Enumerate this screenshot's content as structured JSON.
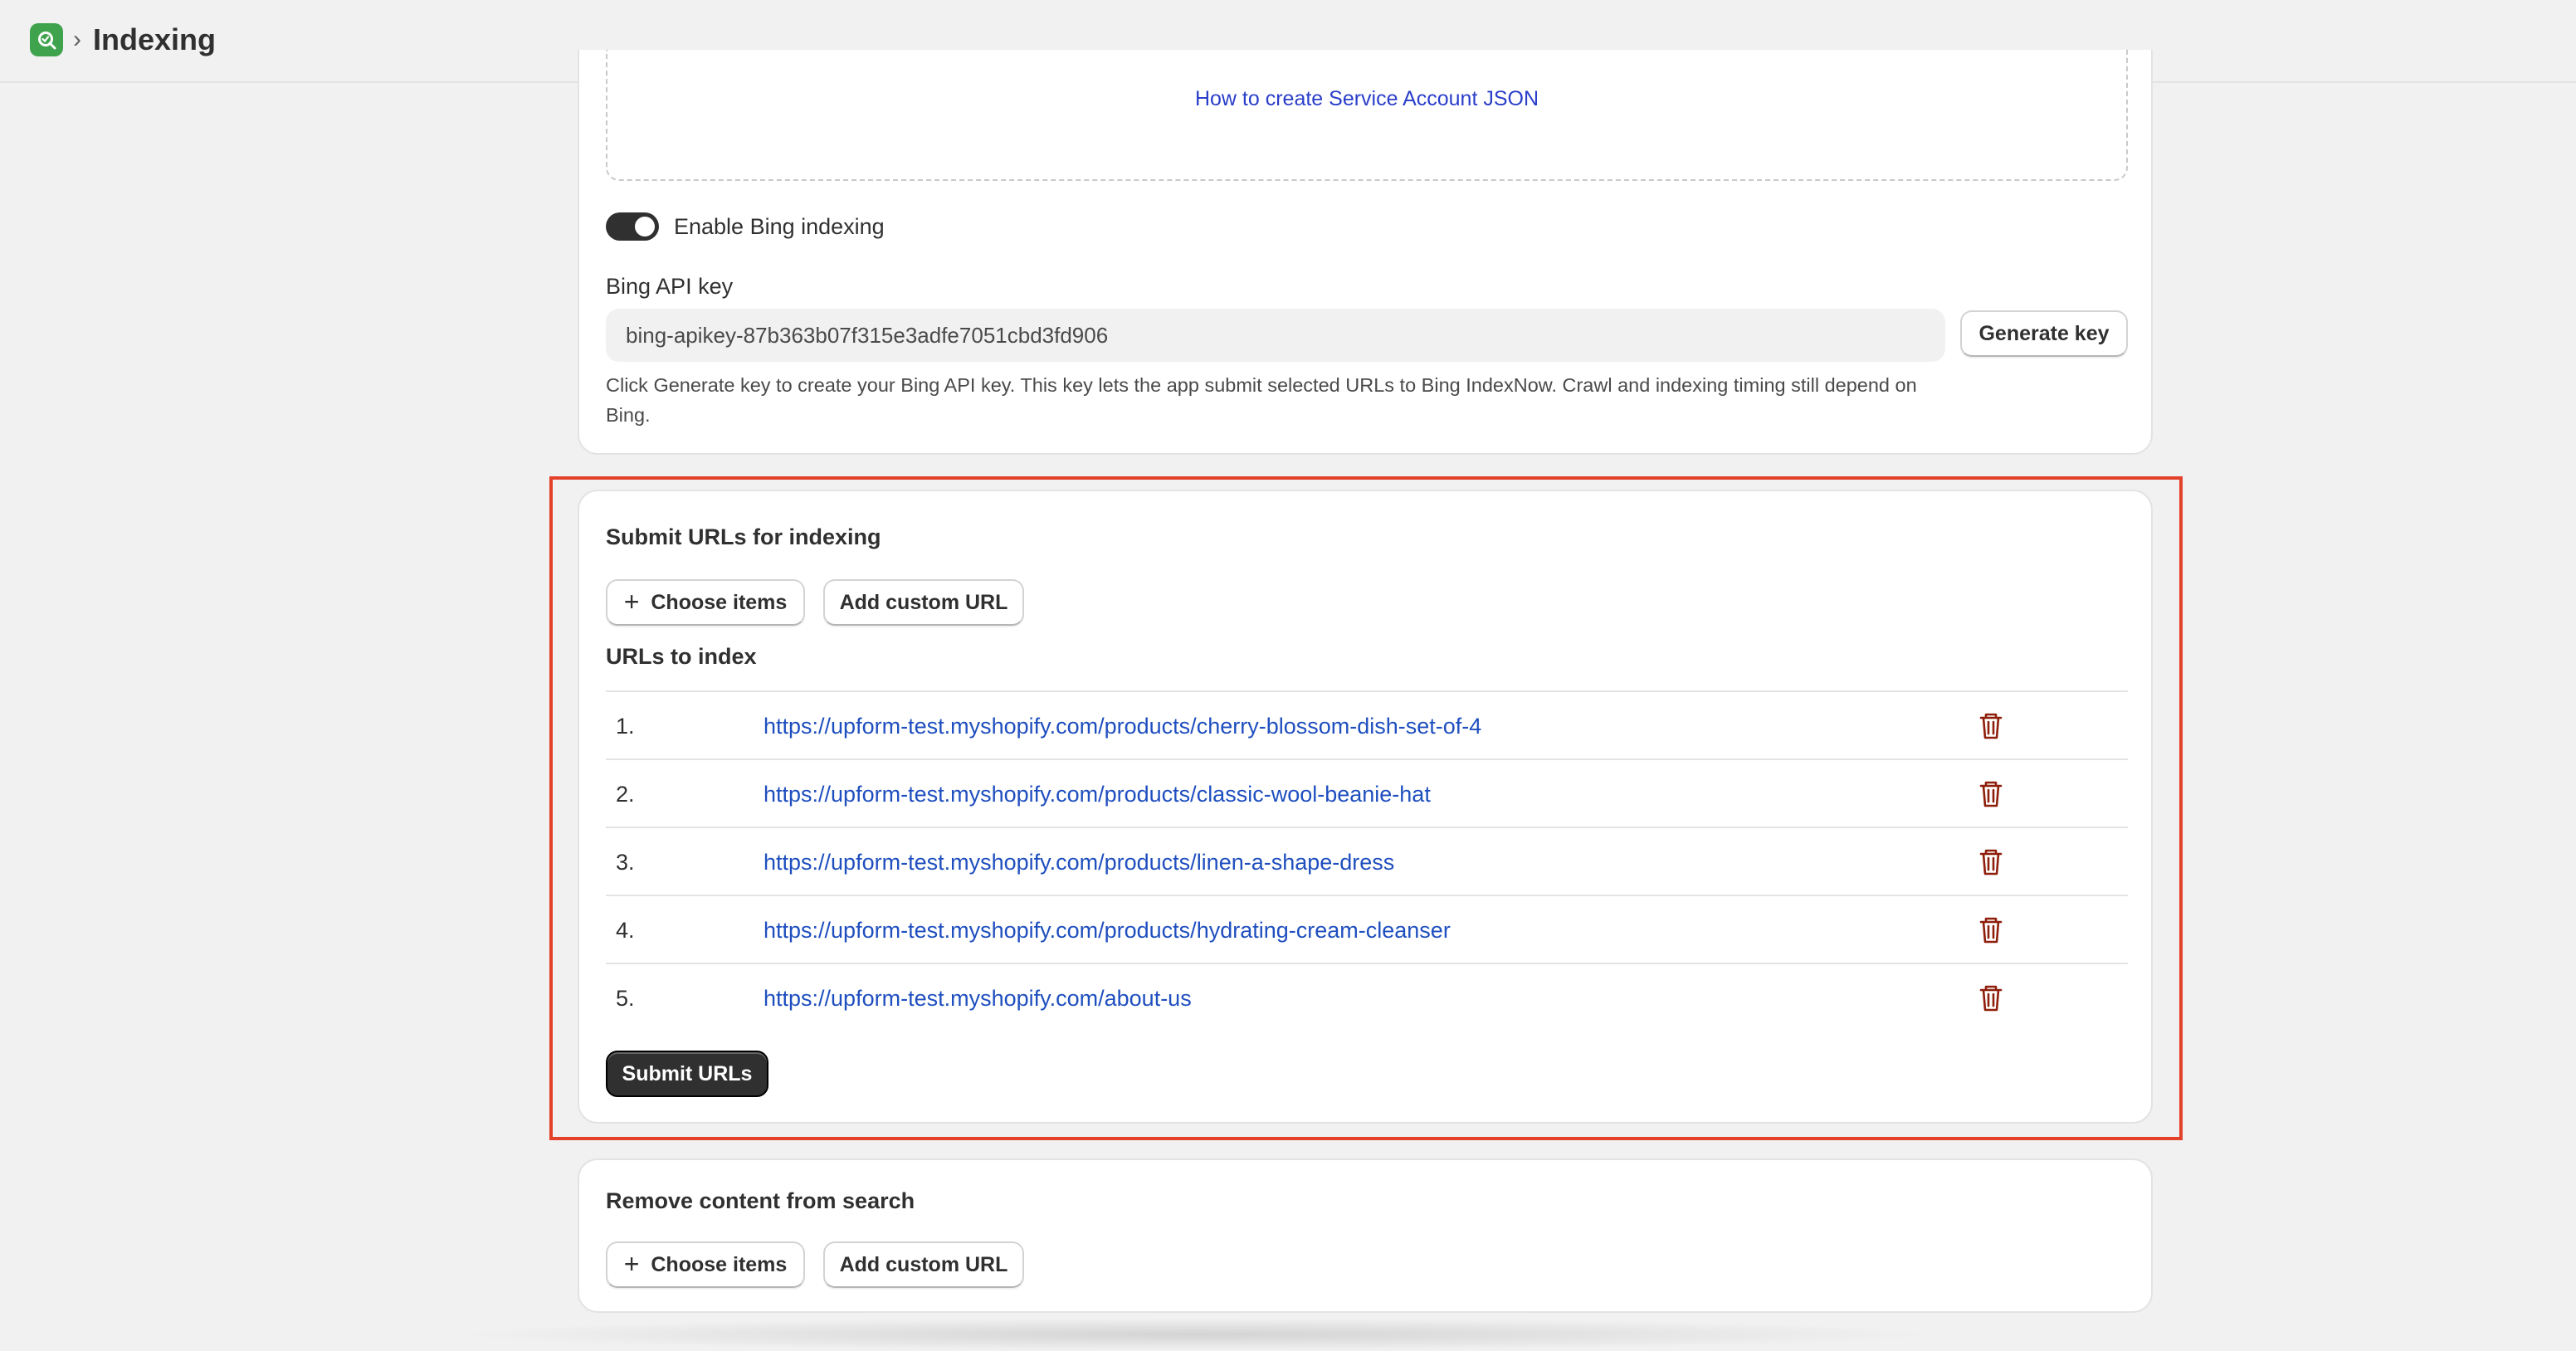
{
  "header": {
    "separator": "›",
    "title": "Indexing",
    "app_icon": "app-logo-icon"
  },
  "google_section": {
    "howto_link": "How to create Service Account JSON"
  },
  "bing": {
    "toggle_label": "Enable Bing indexing",
    "toggle_on": true,
    "api_key_label": "Bing API key",
    "api_key_value": "bing-apikey-87b363b07f315e3adfe7051cbd3fd906",
    "generate_label": "Generate key",
    "help_text": "Click Generate key to create your Bing API key. This key lets the app submit selected URLs to Bing IndexNow. Crawl and indexing timing still depend on Bing."
  },
  "submit_section": {
    "heading": "Submit URLs for indexing",
    "choose_label": "Choose items",
    "custom_label": "Add custom URL",
    "list_heading": "URLs to index",
    "urls": [
      {
        "num": "1.",
        "url": "https://upform-test.myshopify.com/products/cherry-blossom-dish-set-of-4"
      },
      {
        "num": "2.",
        "url": "https://upform-test.myshopify.com/products/classic-wool-beanie-hat"
      },
      {
        "num": "3.",
        "url": "https://upform-test.myshopify.com/products/linen-a-shape-dress"
      },
      {
        "num": "4.",
        "url": "https://upform-test.myshopify.com/products/hydrating-cream-cleanser"
      },
      {
        "num": "5.",
        "url": "https://upform-test.myshopify.com/about-us"
      }
    ],
    "submit_label": "Submit URLs"
  },
  "remove_section": {
    "heading": "Remove content from search",
    "choose_label": "Choose items",
    "custom_label": "Add custom URL"
  },
  "colors": {
    "highlight": "#e4412a",
    "link": "#1f4fbf",
    "delete_icon": "#8e1f0b",
    "primary_button": "#303030"
  }
}
